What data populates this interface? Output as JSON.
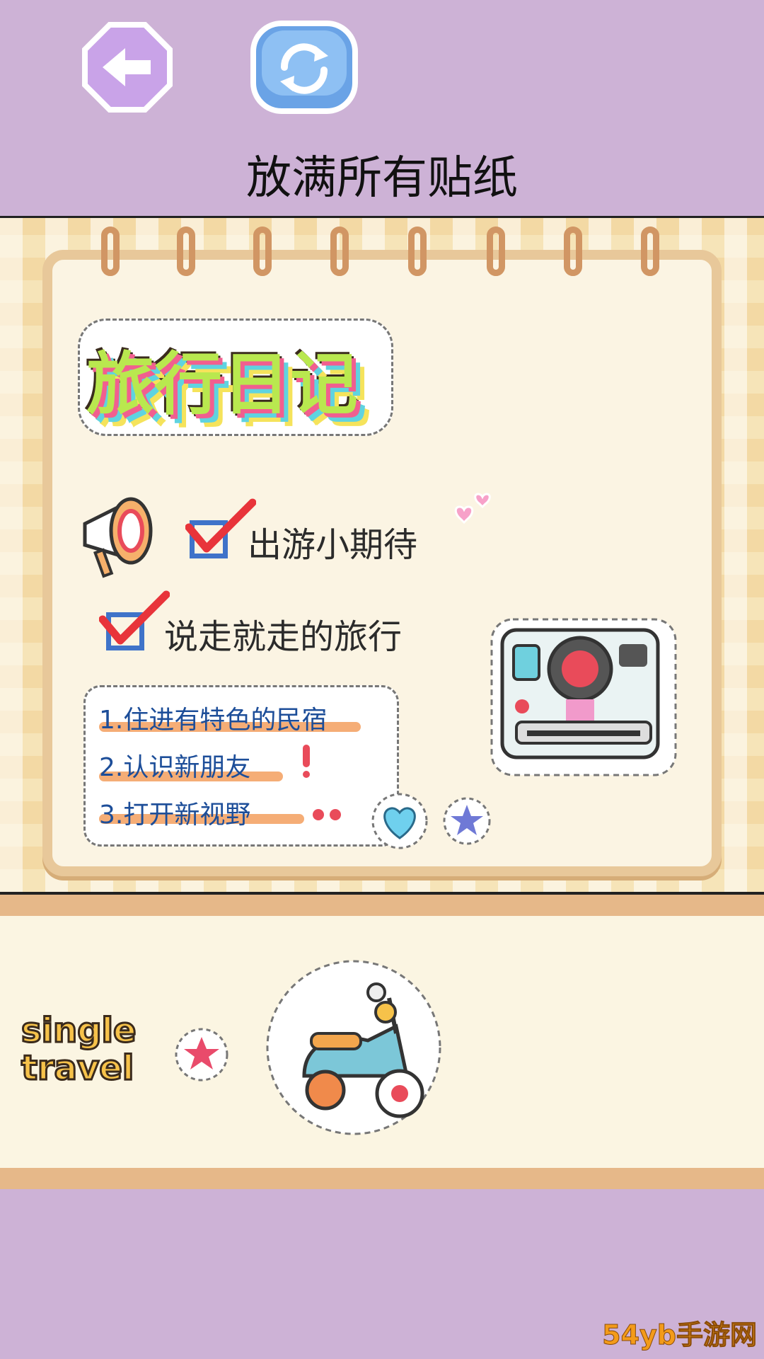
{
  "header": {
    "title": "放满所有贴纸"
  },
  "diary": {
    "title": "旅行日记",
    "checks": [
      {
        "label": "出游小期待",
        "checked": true
      },
      {
        "label": "说走就走的旅行",
        "checked": true
      }
    ],
    "list": [
      "1.住进有特色的民宿",
      "2.认识新朋友",
      "3.打开新视野"
    ]
  },
  "tray": {
    "sticker_text": [
      "single",
      "travel"
    ]
  },
  "watermark": "54yb手游网"
}
